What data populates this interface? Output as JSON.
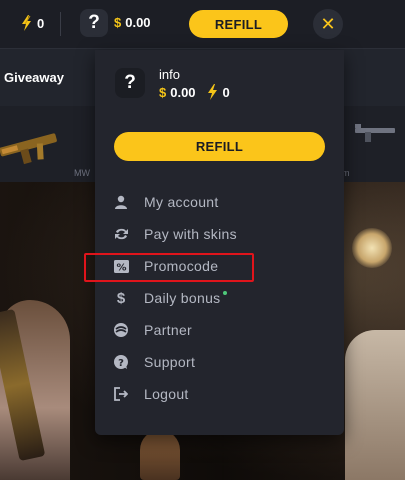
{
  "topbar": {
    "coins": "0",
    "avatar_glyph": "?",
    "balance": "0.00",
    "currency_symbol": "$",
    "refill_label": "REFILL",
    "close_glyph": "✕"
  },
  "background": {
    "giveaway_label": "Giveaway",
    "skin_wear_left": "MW",
    "skin_wear_right": "m"
  },
  "dropdown": {
    "avatar_glyph": "?",
    "username": "info",
    "currency_symbol": "$",
    "balance": "0.00",
    "coins": "0",
    "refill_label": "REFILL",
    "menu": [
      {
        "label": "My account",
        "icon": "user-icon"
      },
      {
        "label": "Pay with skins",
        "icon": "exchange-icon"
      },
      {
        "label": "Promocode",
        "icon": "percent-ticket-icon",
        "highlighted": true
      },
      {
        "label": "Daily bonus",
        "icon": "dollar-icon",
        "has_new_dot": true
      },
      {
        "label": "Partner",
        "icon": "partner-icon"
      },
      {
        "label": "Support",
        "icon": "question-bubble-icon"
      },
      {
        "label": "Logout",
        "icon": "logout-icon"
      }
    ]
  },
  "colors": {
    "accent": "#fbc51a",
    "highlight_border": "#e0141b",
    "new_dot": "#4ec97a"
  }
}
